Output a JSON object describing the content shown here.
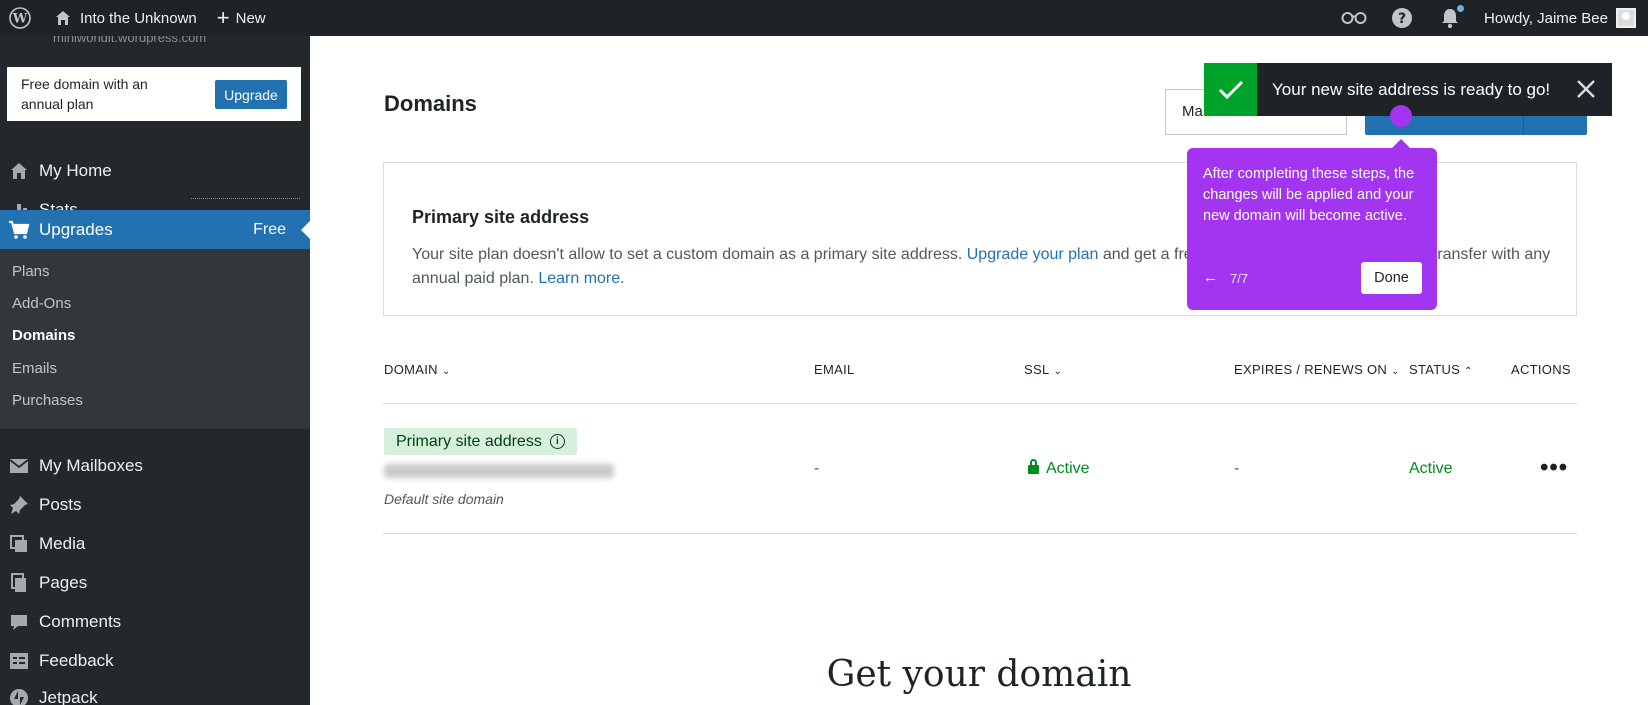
{
  "adminbar": {
    "site_name": "Into the Unknown",
    "new_label": "New",
    "howdy": "Howdy, Jaime Bee"
  },
  "sidebar": {
    "site_url": "miniwondit.wordpress.com",
    "promo": {
      "text": "Free domain with an annual plan",
      "button": "Upgrade"
    },
    "items": [
      {
        "label": "My Home",
        "icon": "home-icon"
      },
      {
        "label": "Stats",
        "icon": "stats-icon"
      },
      {
        "label": "Upgrades",
        "icon": "cart-icon",
        "badge": "Free"
      },
      {
        "label": "My Mailboxes",
        "icon": "mail-icon"
      },
      {
        "label": "Posts",
        "icon": "pin-icon"
      },
      {
        "label": "Media",
        "icon": "media-icon"
      },
      {
        "label": "Pages",
        "icon": "pages-icon"
      },
      {
        "label": "Comments",
        "icon": "comment-icon"
      },
      {
        "label": "Feedback",
        "icon": "feedback-icon"
      },
      {
        "label": "Jetpack",
        "icon": "jetpack-icon"
      }
    ],
    "submenu": [
      "Plans",
      "Add-Ons",
      "Domains",
      "Emails",
      "Purchases"
    ]
  },
  "main": {
    "title": "Domains",
    "manage_button": "Ma",
    "notice": {
      "title": "Primary site address",
      "text_1": "Your site plan doesn't allow to set a custom domain as a primary site address. ",
      "link_1": "Upgrade your plan",
      "text_2": " and get a free one-year domain registration or transfer with any annual paid plan. ",
      "link_2": "Learn more",
      "text_3": "."
    },
    "table": {
      "headers": {
        "domain": "DOMAIN",
        "email": "EMAIL",
        "ssl": "SSL",
        "expires": "EXPIRES / RENEWS ON",
        "status": "STATUS",
        "actions": "ACTIONS"
      },
      "row": {
        "badge": "Primary site address",
        "sublabel": "Default site domain",
        "email": "-",
        "ssl": "Active",
        "expires": "-",
        "status": "Active",
        "actions": "•••"
      }
    },
    "get_domain": "Get your domain"
  },
  "snackbar": {
    "text": "Your new site address is ready to go!"
  },
  "tour": {
    "text": "After completing these steps, the changes will be applied and your new domain will become active.",
    "back": "←",
    "count": "7/7",
    "done": "Done"
  },
  "colors": {
    "accent": "#2271b1",
    "sidebar_bg": "#23282d",
    "tour_purple": "#a335f0",
    "success": "#00a32a"
  }
}
